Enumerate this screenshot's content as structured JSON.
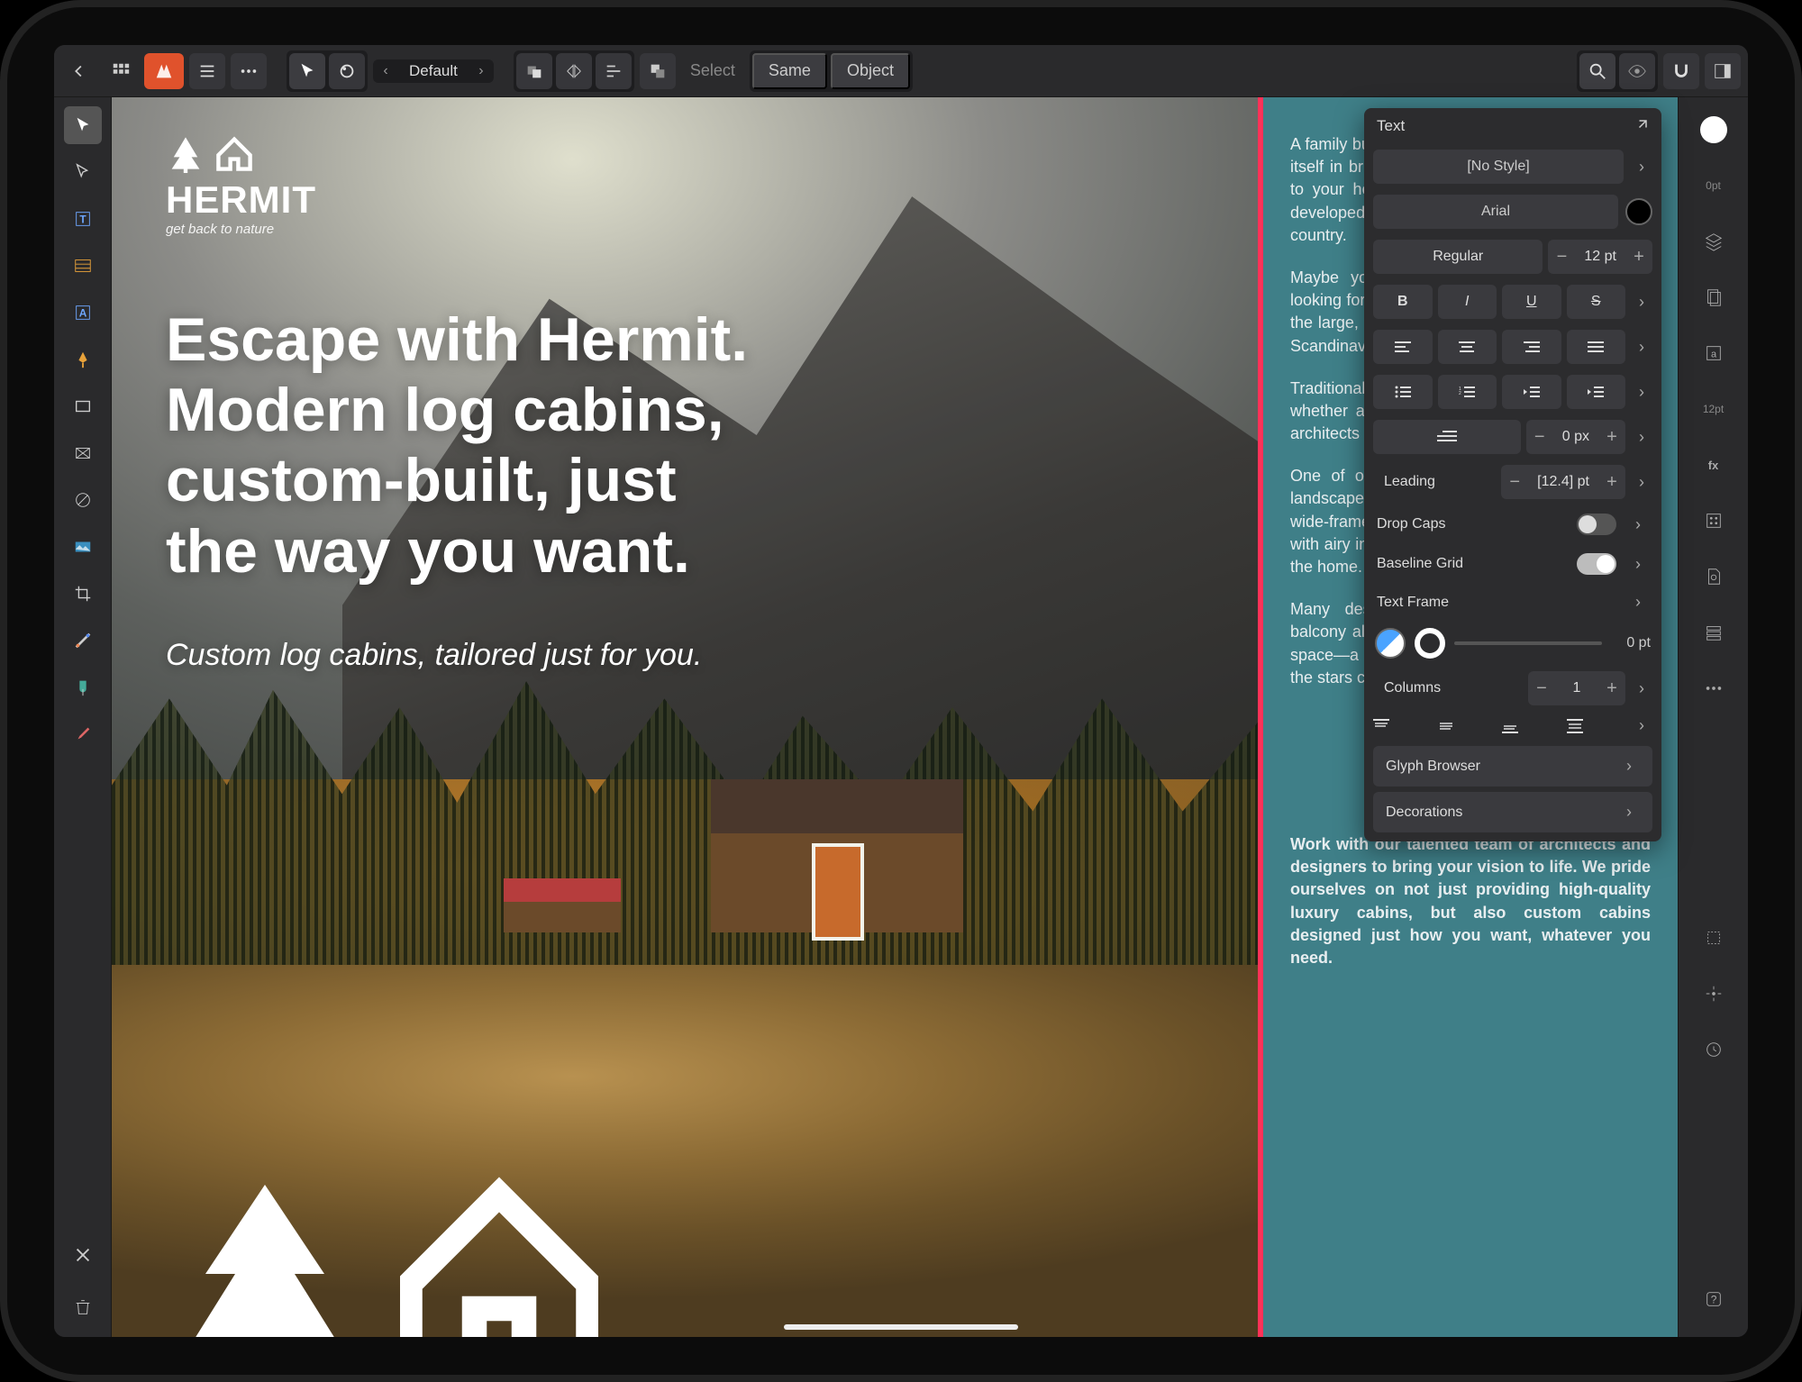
{
  "topbar": {
    "persona_label": "Default",
    "select_label": "Select",
    "seg_same": "Same",
    "seg_object": "Object"
  },
  "canvas": {
    "brand_word": "HERMIT",
    "brand_tag": "get back to nature",
    "hero_l1": "Escape with Hermit.",
    "hero_l2": "Modern log cabins,",
    "hero_l3": "custom-built, just",
    "hero_l4": "the way you want.",
    "subhero": "Custom log cabins, tailored just for you."
  },
  "tealcol": {
    "p1": "A family business going since 2005, Hermit prides itself in bringing the basic luxury of the log cabin to your home. Over 20 years, we've designed, developed and provided log cabins across the country.",
    "p2": "Maybe you just need extra space, or you're looking for a place to call home. From the small to the large, our unique designs draw on Nordic and Scandinavian influences.",
    "p3": "Traditional comfort and cosiness is our priority—whether a getaway or a sanctuary, our team of architects are here to help.",
    "p4": "One of our cabins effortlessly blends into the landscape. Deep black exteriors, natural timber, wide-framed windows—it's more rather than less, with airy interior spaces that bring the outside into the home.",
    "p5": "Many designs include a mezzanine, whose balcony allows its residents to overlook the living space—a feature loved by families—from which the stars can be admired.",
    "p_bold": "Work with our talented team of architects and designers to bring your vision to life. We pride ourselves on not just providing high-quality luxury cabins, but also custom cabins designed just how you want, whatever you need."
  },
  "textpanel": {
    "title": "Text",
    "style": "[No Style]",
    "font": "Arial",
    "weight": "Regular",
    "size": "12 pt",
    "indent": "0 px",
    "leading_label": "Leading",
    "leading_value": "[12.4] pt",
    "dropcaps_label": "Drop Caps",
    "baseline_label": "Baseline Grid",
    "textframe_label": "Text Frame",
    "stroke_value": "0 pt",
    "columns_label": "Columns",
    "columns_value": "1",
    "glyph_label": "Glyph Browser",
    "decorations_label": "Decorations"
  },
  "rstrip": {
    "zero_label": "0pt",
    "twelve_label": "12pt"
  }
}
